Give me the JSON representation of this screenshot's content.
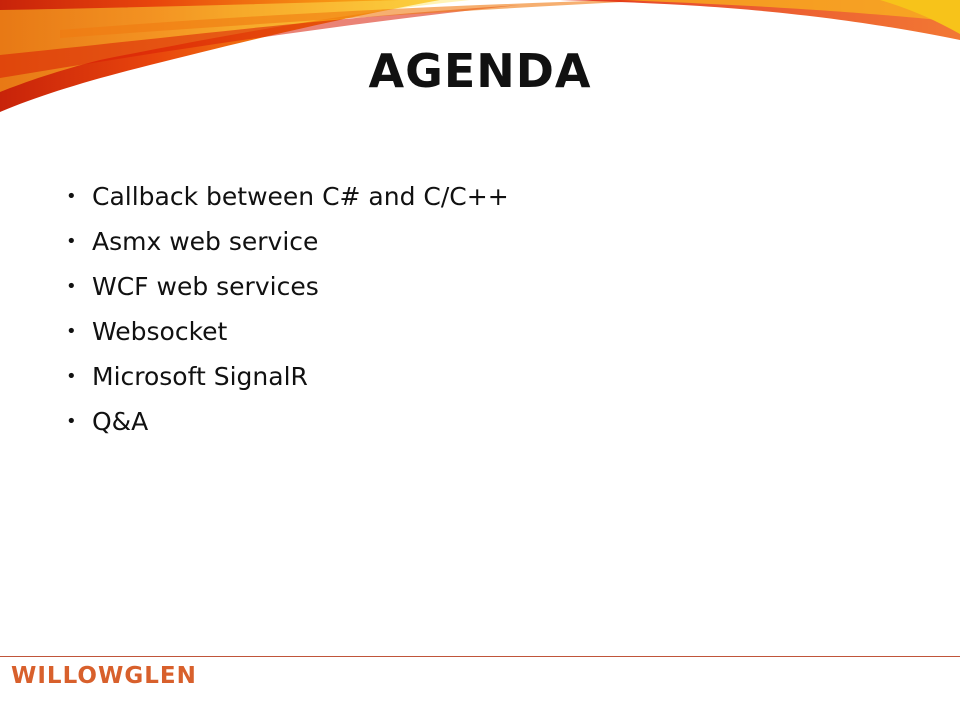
{
  "slide": {
    "title": "AGENDA",
    "bullet_char": "•",
    "items": [
      "Callback between C# and C/C++",
      "Asmx web service",
      "WCF web services",
      "Websocket",
      "Microsoft SignalR",
      "Q&A"
    ]
  },
  "footer": {
    "logo_text": "WILLOWGLEN"
  },
  "colors": {
    "swoosh_red": "#d81e05",
    "swoosh_orange": "#f07a10",
    "swoosh_yellow": "#f7c31a",
    "footer_line": "#c0553a",
    "logo": "#d8602c"
  }
}
